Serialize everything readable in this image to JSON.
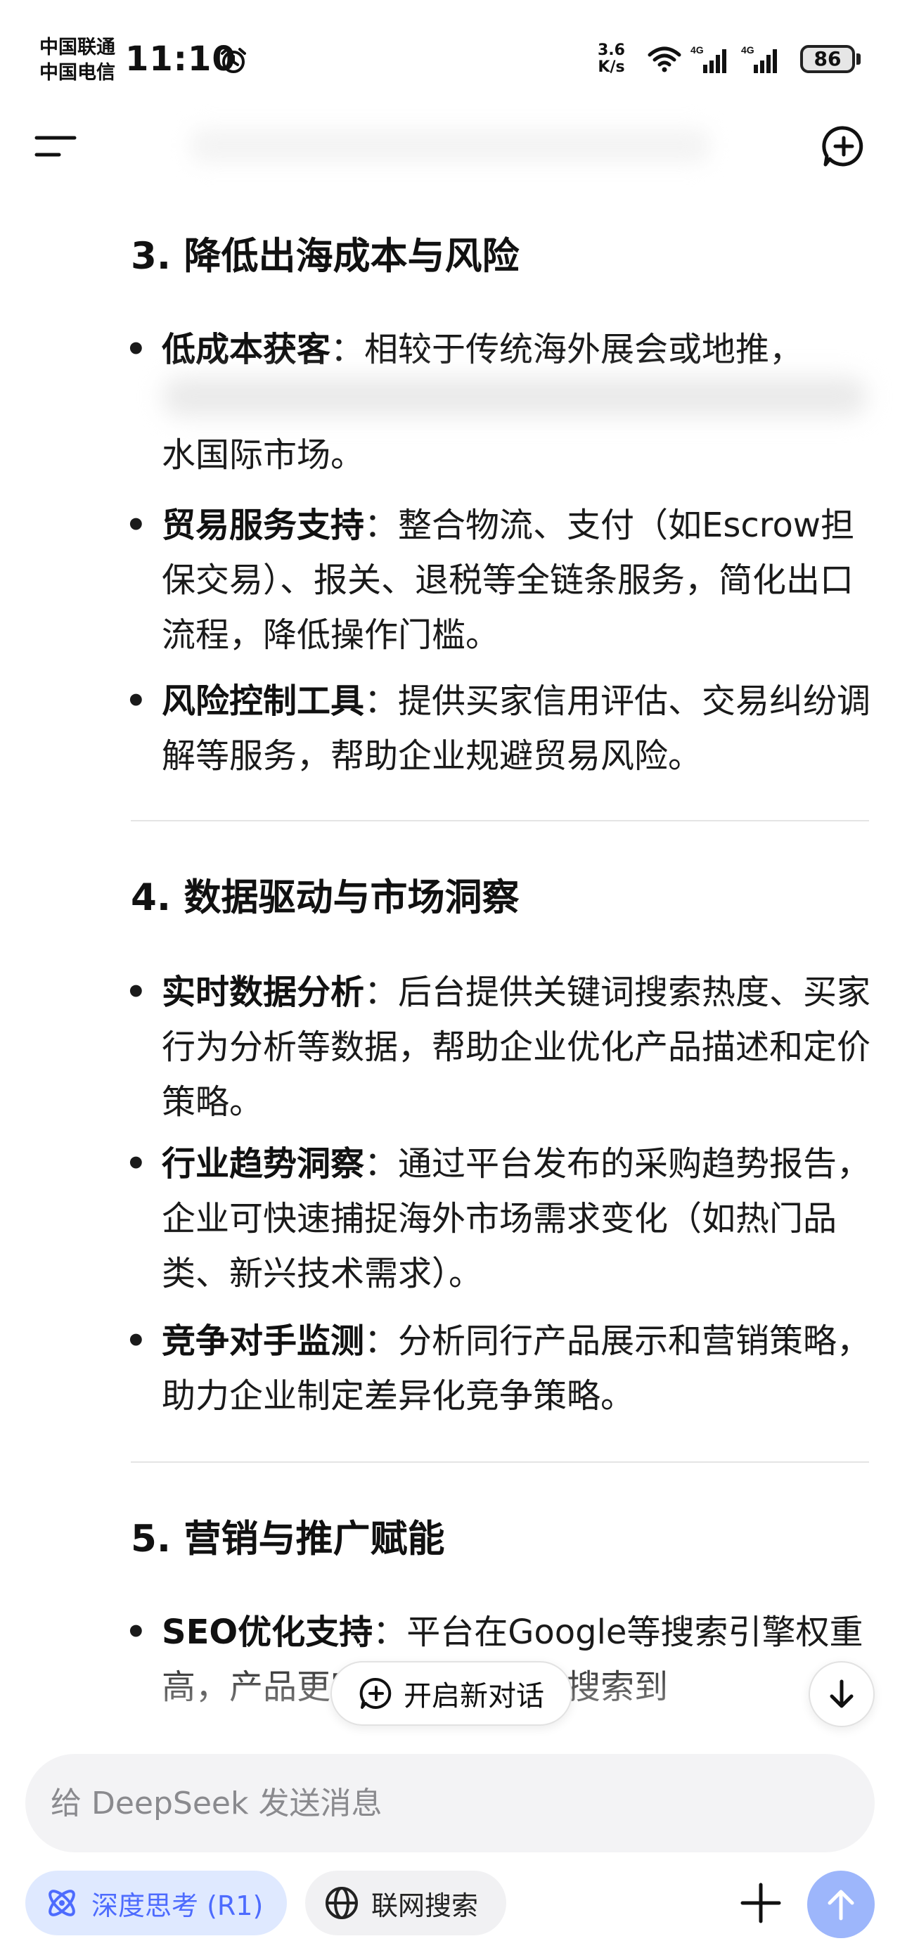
{
  "status_bar": {
    "carrier_1": "中国联通",
    "carrier_2": "中国电信",
    "time": "11:10",
    "net_speed_value": "3.6",
    "net_speed_unit": "K/s",
    "signal_1_label": "4G",
    "signal_2_label": "4G",
    "battery": "86",
    "icons": [
      "alarm-icon",
      "wifi-icon",
      "signal-icon",
      "signal-icon"
    ]
  },
  "header": {
    "menu_icon": "menu-icon",
    "new_chat_icon": "new-chat-icon"
  },
  "sections": [
    {
      "heading": "3. 降低出海成本与风险",
      "items": [
        {
          "bold": "低成本获客",
          "sep": "：",
          "text": "相较于传统海外展会或地推，"
        },
        {
          "bold": "",
          "sep": "",
          "text": "水国际市场。"
        },
        {
          "bold": "贸易服务支持",
          "sep": "：",
          "text": "整合物流、支付（如Escrow担保交易）、报关、退税等全链条服务，简化出口流程，降低操作门槛。"
        },
        {
          "bold": "风险控制工具",
          "sep": "：",
          "text": "提供买家信用评估、交易纠纷调解等服务，帮助企业规避贸易风险。"
        }
      ]
    },
    {
      "heading": "4. 数据驱动与市场洞察",
      "items": [
        {
          "bold": "实时数据分析",
          "sep": "：",
          "text": "后台提供关键词搜索热度、买家行为分析等数据，帮助企业优化产品描述和定价策略。"
        },
        {
          "bold": "行业趋势洞察",
          "sep": "：",
          "text": "通过平台发布的采购趋势报告，企业可快速捕捉海外市场需求变化（如热门品类、新兴技术需求）。"
        },
        {
          "bold": "竞争对手监测",
          "sep": "：",
          "text": "分析同行产品展示和营销策略，助力企业制定差异化竞争策略。"
        }
      ]
    },
    {
      "heading": "5. 营销与推广赋能",
      "items": [
        {
          "bold": "SEO优化支持",
          "sep": "：",
          "text": "平台在Google等搜索引擎权重高，产品更容易被国际买家搜索到"
        }
      ]
    }
  ],
  "floating": {
    "new_chat_label": "开启新对话",
    "scroll_down_icon": "arrow-down-icon"
  },
  "composer": {
    "placeholder": "给 DeepSeek 发送消息",
    "value": ""
  },
  "toolbar": {
    "deep_think_label": "深度思考 (R1)",
    "web_search_label": "联网搜索",
    "deep_think_color": "#4d6bfe",
    "send_color": "#9db6fb"
  }
}
